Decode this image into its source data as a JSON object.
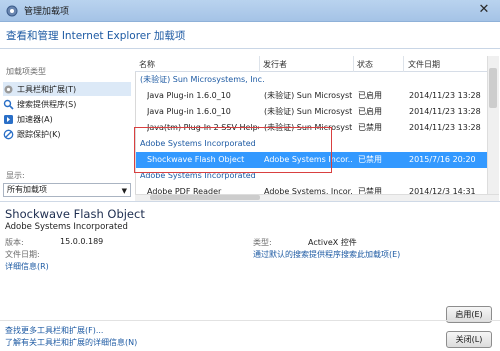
{
  "window": {
    "title": "管理加载项",
    "header": "查看和管理 Internet Explorer 加载项"
  },
  "sidebar": {
    "types_label": "加载项类型",
    "items": [
      {
        "label": "工具栏和扩展(T)",
        "icon": "gear-icon"
      },
      {
        "label": "搜索提供程序(S)",
        "icon": "search-icon"
      },
      {
        "label": "加速器(A)",
        "icon": "accelerator-icon"
      },
      {
        "label": "跟踪保护(K)",
        "icon": "tracking-protection-icon"
      }
    ],
    "show_label": "显示:",
    "show_value": "所有加载项"
  },
  "list": {
    "columns": [
      "名称",
      "发行者",
      "状态",
      "文件日期"
    ],
    "rows": [
      {
        "kind": "group",
        "name": "(未验证) Sun Microsystems, Inc."
      },
      {
        "kind": "item",
        "name": "Java Plug-in 1.6.0_10",
        "publisher": "(未验证) Sun Microsyst...",
        "status": "已启用",
        "date": "2014/11/23 13:28"
      },
      {
        "kind": "item",
        "name": "Java Plug-in 1.6.0_10",
        "publisher": "(未验证) Sun Microsyst...",
        "status": "已启用",
        "date": "2014/11/23 13:28"
      },
      {
        "kind": "item",
        "name": "Java(tm) Plug-In 2 SSV Helper",
        "publisher": "(未验证) Sun Microsyst...",
        "status": "已禁用",
        "date": "2014/11/23 13:28"
      },
      {
        "kind": "group",
        "name": "Adobe Systems Incorporated"
      },
      {
        "kind": "selected",
        "name": "Shockwave Flash Object",
        "publisher": "Adobe Systems Incor...",
        "status": "已禁用",
        "date": "2015/7/16 20:20"
      },
      {
        "kind": "group",
        "name": "Adobe Systems Incorporated"
      },
      {
        "kind": "item",
        "name": "Adobe PDF Reader",
        "publisher": "Adobe Systems, Incor...",
        "status": "已禁用",
        "date": "2014/12/3 14:31"
      }
    ]
  },
  "details": {
    "title": "Shockwave Flash Object",
    "publisher": "Adobe Systems Incorporated",
    "version_label": "版本:",
    "version_value": "15.0.0.189",
    "filedate_label": "文件日期:",
    "more_info": "详细信息(R)",
    "type_label": "类型:",
    "type_value": "ActiveX 控件",
    "search_link": "通过默认的搜索提供程序搜索此加载项(E)"
  },
  "footer": {
    "link1": "查找更多工具栏和扩展(F)...",
    "link2": "了解有关工具栏和扩展的详细信息(N)",
    "enable_button": "启用(E)",
    "close_button": "关闭(L)"
  }
}
